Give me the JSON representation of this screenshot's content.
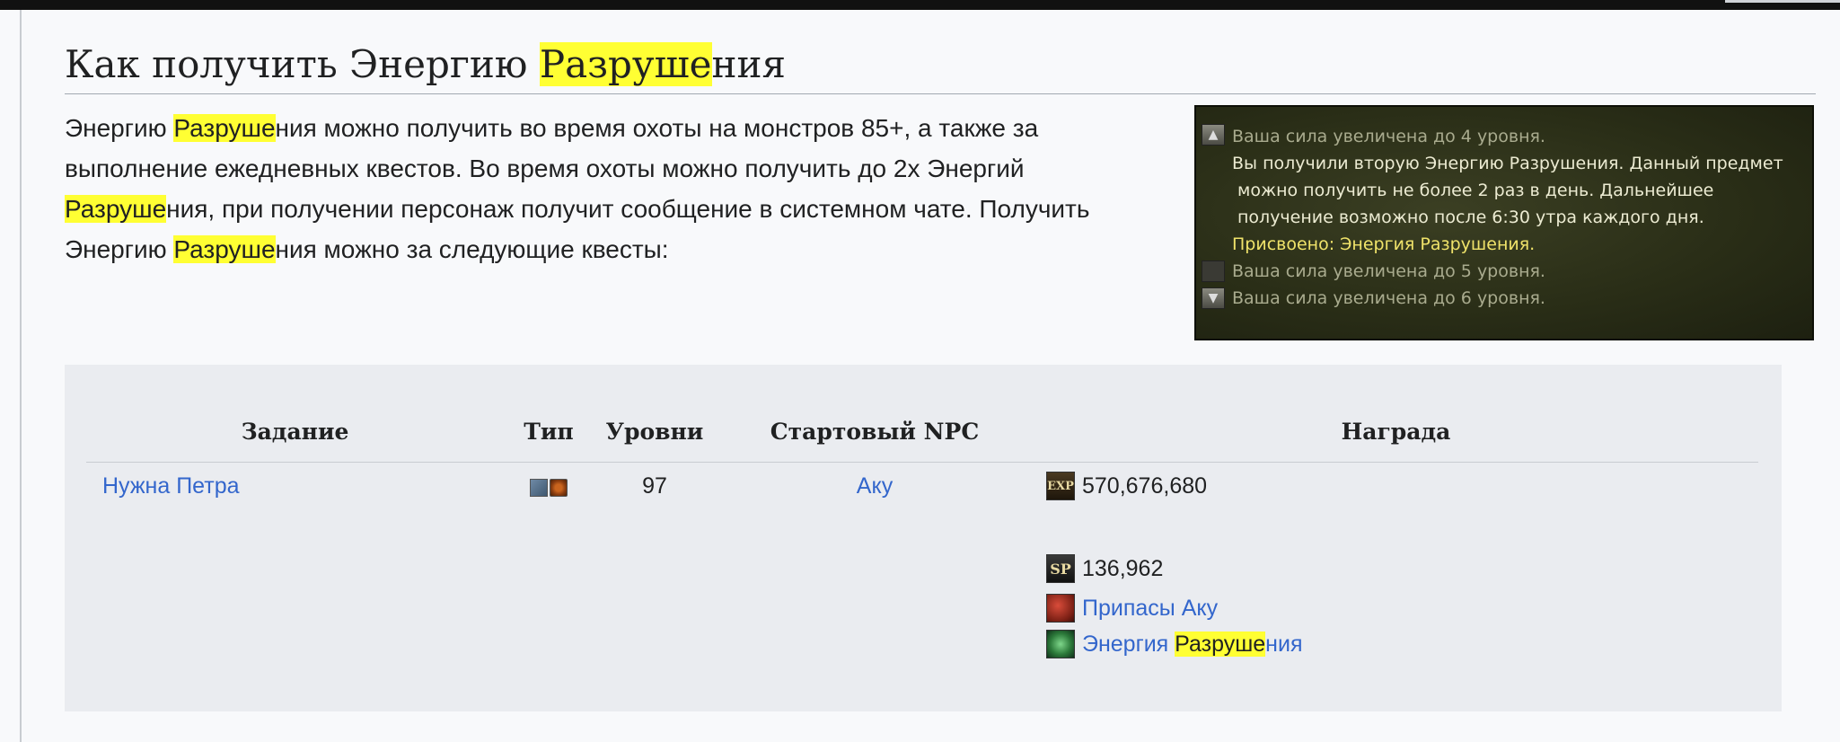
{
  "heading": {
    "before": "Как получить Энергию ",
    "highlight": "Разруше",
    "after": "ния"
  },
  "intro": {
    "s1": "Энергию ",
    "h1": "Разруше",
    "s2": "ния можно получить во время охоты на монстров 85+, а также за выполнение ежедневных квестов. Во время охоты можно получить до 2х Энергий ",
    "h2": "Разруше",
    "s3": "ния, при получении персонаж получит сообщение в системном чате. Получить Энергию ",
    "h3": "Разруше",
    "s4": "ния можно за следующие квесты:"
  },
  "screenshot_chat": {
    "lines": [
      "Ваша сила увеличена до 4 уровня.",
      "Вы получили вторую Энергию Разрушения. Данный предмет",
      "можно получить не более 2 раз в день. Дальнейшее",
      "получение возможно после 6:30 утра каждого дня.",
      "Присвоено: Энергия Разрушения.",
      "Ваша сила увеличена до 5 уровня.",
      "Ваша сила увеличена до 6 уровня."
    ]
  },
  "table": {
    "headers": {
      "quest": "Задание",
      "type": "Тип",
      "levels": "Уровни",
      "npc": "Стартовый NPC",
      "reward": "Награда"
    },
    "rows": [
      {
        "quest": "Нужна Петра",
        "level": "97",
        "npc": "Аку",
        "exp_label": "EXP",
        "exp": "570,676,680",
        "sp_label": "SP",
        "sp": "136,962",
        "item1": "Припасы Аку",
        "item2_before": "Энергия ",
        "item2_highlight": "Разруше",
        "item2_after": "ния"
      }
    ]
  },
  "colors": {
    "link": "#3366cc",
    "highlight": "#ffff33",
    "table_bg": "#eaecf0",
    "page_bg": "#f8f9fb"
  }
}
